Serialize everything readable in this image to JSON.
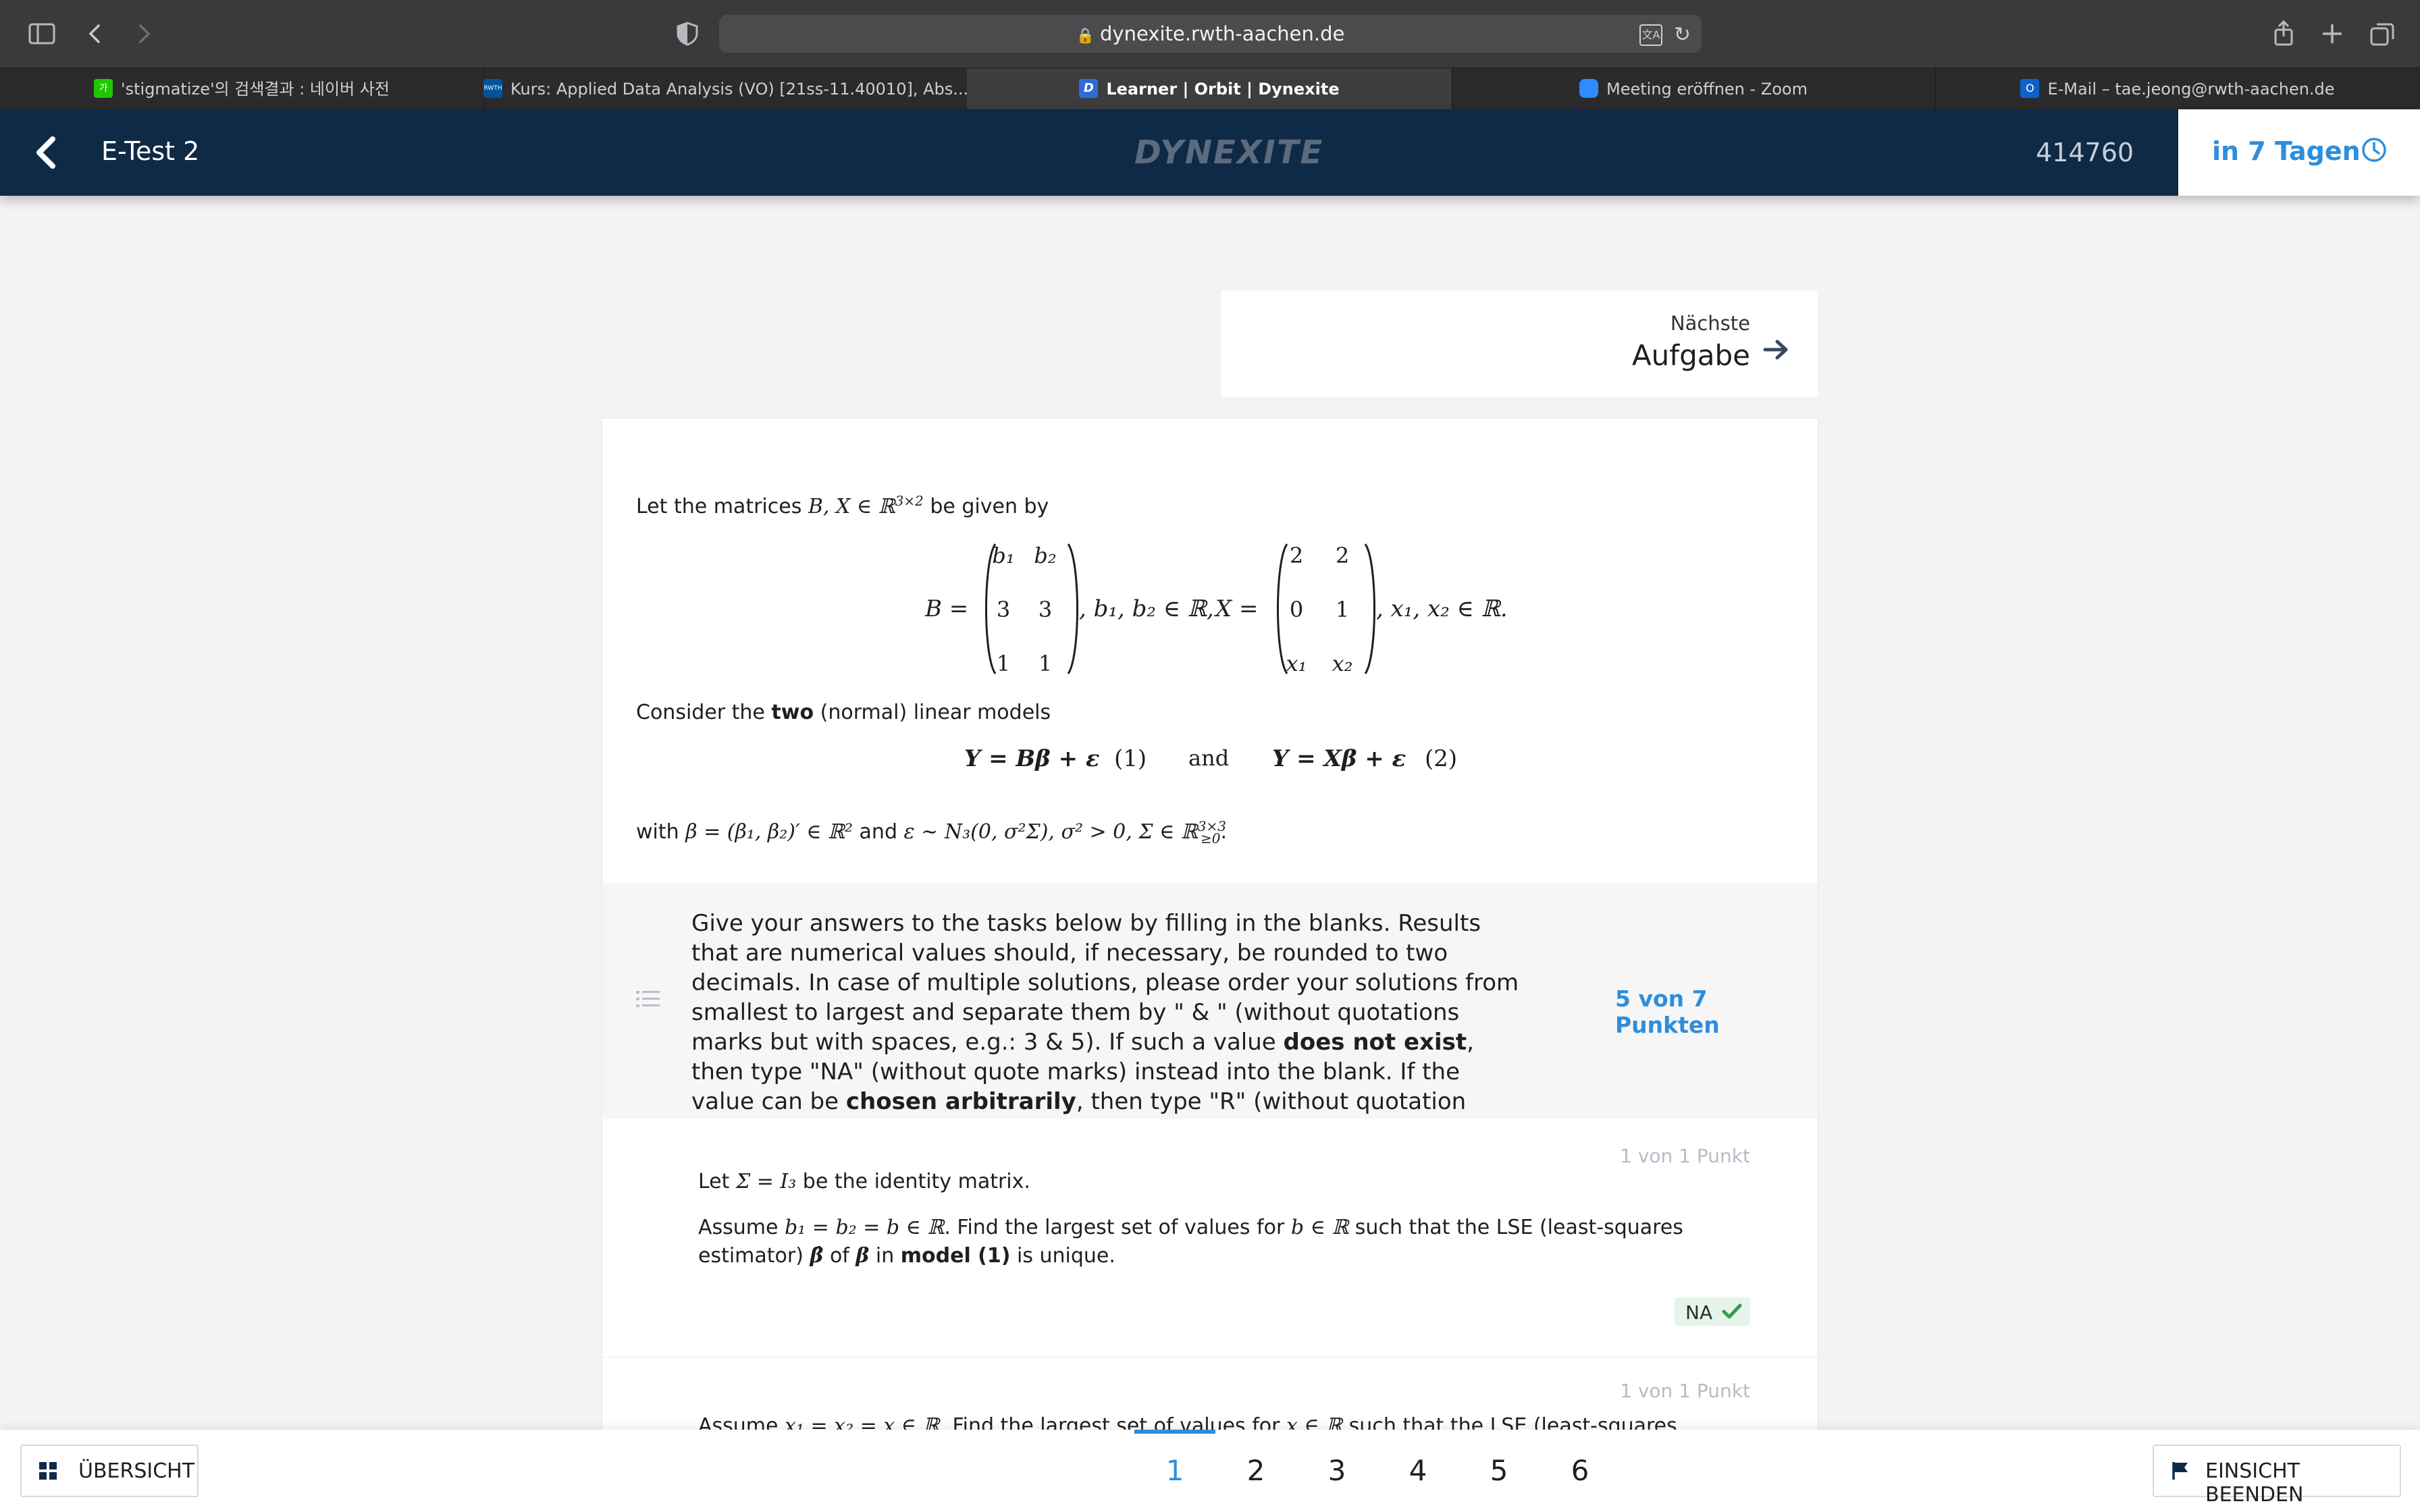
{
  "browser": {
    "url": "dynexite.rwth-aachen.de",
    "tabs": [
      {
        "label": "'stigmatize'의 검색결과 : 네이버 사전",
        "favicon_color": "#1ec800",
        "favicon_text": "가"
      },
      {
        "label": "Kurs: Applied Data Analysis (VO) [21ss-11.40010], Abs...",
        "favicon_color": "#00549f",
        "favicon_text": "RWTH"
      },
      {
        "label": "Learner | Orbit | Dynexite",
        "favicon_color": "#2f6bd6",
        "favicon_text": "D"
      },
      {
        "label": "Meeting eröffnen - Zoom",
        "favicon_color": "#2d8cff",
        "favicon_text": ""
      },
      {
        "label": "E-Mail – tae.jeong@rwth-aachen.de",
        "favicon_color": "#0a64c8",
        "favicon_text": "O"
      }
    ],
    "active_tab": 2
  },
  "header": {
    "title": "E-Test 2",
    "logo": "DYNEXITE",
    "user_id": "414760",
    "deadline": "in 7 Tagen"
  },
  "next": {
    "small": "Nächste",
    "big": "Aufgabe"
  },
  "problem": {
    "intro_pre": "Let the matrices ",
    "intro_math": "B, X ∈ ℝ",
    "intro_sup": "3×2",
    "intro_post": " be given by",
    "B_label": "B =",
    "B_cells": [
      "b₁",
      "b₂",
      "3",
      "3",
      "1",
      "1"
    ],
    "B_suffix": ", b₁, b₂ ∈ ℝ,",
    "X_label": "X =",
    "X_cells": [
      "2",
      "2",
      "0",
      "1",
      "x₁",
      "x₂"
    ],
    "X_suffix": ", x₁, x₂ ∈ ℝ.",
    "consider_pre": "Consider the ",
    "consider_bold": "two",
    "consider_post": " (normal) linear models",
    "model1": "Y = Bβ + ε",
    "model1_num": "(1)",
    "models_and": "and",
    "model2": "Y = Xβ + ε",
    "model2_num": "(2)",
    "with_pre": "with ",
    "with_beta": "β = (β₁, β₂)′ ∈ ℝ²",
    "with_and": " and ",
    "with_eps": "ε ∼ N₃(0, σ²Σ), σ² > 0, Σ ∈ ℝ",
    "with_sup": "3×3",
    "with_sub": "≥0",
    "with_end": "."
  },
  "instructions": {
    "part1": "Give your answers to the tasks below by filling in the blanks. Results that are numerical values should, if necessary, be rounded to two decimals. In case of multiple solutions, please order your solutions from smallest to largest and separate them by \" & \" (without quotations marks but with spaces, e.g.: 3 & 5). If such a value ",
    "bold1": "does not exist",
    "part2": ", then type \"NA\" (without quote marks) instead into the blank. If the value can be ",
    "bold2": "chosen arbitrarily",
    "part3": ", then type \"R\" (without quotation marks) instead into the blank.",
    "points": "5 von 7 Punkten"
  },
  "tasks": [
    {
      "points": "1 von 1 Punkt",
      "line1_pre": "Let ",
      "line1_math": "Σ = I₃",
      "line1_post": " be the identity matrix.",
      "line2_pre": "Assume ",
      "line2_math1": "b₁ = b₂ = b ∈ ℝ",
      "line2_mid1": ". Find the largest set of values for ",
      "line2_math2": "b ∈ ℝ",
      "line2_mid2": " such that the LSE (least-squares estimator) ",
      "line2_math3": "β̂",
      "line2_mid3": " of ",
      "line2_math4": "β",
      "line2_mid4": " in ",
      "line2_bold": "model (1)",
      "line2_end": " is unique.",
      "answer": "NA",
      "answer_correct": true
    },
    {
      "points": "1 von 1 Punkt",
      "line_pre": "Assume ",
      "line_math": "x₁ = x₂ = x ∈ ℝ",
      "line_mid": ". Find the largest set of values for ",
      "line_math2": "x ∈ ℝ",
      "line_end": " such that the LSE (least-squares estimator) β̂ of β"
    }
  ],
  "footer": {
    "overview": "ÜBERSICHT",
    "pages": [
      "1",
      "2",
      "3",
      "4",
      "5",
      "6"
    ],
    "active_page": 1,
    "end": "EINSICHT BEENDEN"
  },
  "colors": {
    "appbar": "#0f2a47",
    "accent": "#2f8ddb",
    "correct": "#2e9e4f"
  }
}
